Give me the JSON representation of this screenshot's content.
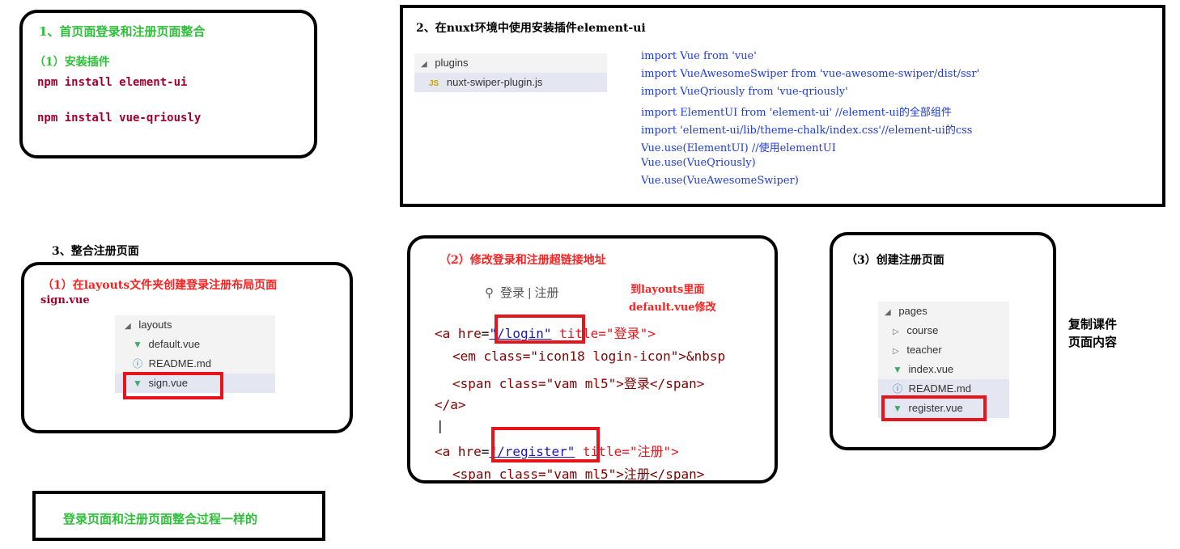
{
  "step1": {
    "title": "1、首页面登录和注册页面整合",
    "subtitle": "（1）安装插件",
    "cmd1": "npm install element-ui",
    "cmd2": "npm install vue-qriously"
  },
  "step2": {
    "title": "2、在nuxt环境中使用安装插件element-ui",
    "tree": {
      "folder": "plugins",
      "file_badge": "JS",
      "file": "nuxt-swiper-plugin.js"
    },
    "code": [
      "import Vue from 'vue'",
      "import VueAwesomeSwiper from 'vue-awesome-swiper/dist/ssr'",
      "import VueQriously from 'vue-qriously'",
      "import ElementUI from 'element-ui' //element-ui的全部组件",
      "import 'element-ui/lib/theme-chalk/index.css'//element-ui的css",
      "Vue.use(ElementUI) //使用elementUI",
      "Vue.use(VueQriously)",
      "Vue.use(VueAwesomeSwiper)"
    ]
  },
  "step3": {
    "title": "3、整合注册页面",
    "sub1_line1": "（1）在layouts文件夹创建登录注册布局页面",
    "sub1_line2": "sign.vue",
    "tree": {
      "folder": "layouts",
      "items": [
        "default.vue",
        "README.md",
        "sign.vue"
      ]
    }
  },
  "step4": {
    "title": "（2）修改登录和注册超链接地址",
    "login_widget": {
      "login": "登录",
      "sep": "|",
      "register": "注册"
    },
    "note_line1": "到layouts里面",
    "note_line2": "default.vue修改",
    "code": {
      "a_open": "<a hre",
      "login_eq": "=",
      "login_href": "\"/login\"",
      "login_title": " title=\"登录\">",
      "em_line": "<em class=\"icon18 login-icon\">&nbsp",
      "span_login": "<span class=\"vam ml5\">登录</span>",
      "a_close": "</a>",
      "cursor": "|",
      "register_href": "\"/register\"",
      "register_title": " title=\"注册\">",
      "span_register": "<span class=\"vam ml5\">注册</span>"
    }
  },
  "step5": {
    "title": "（3）创建注册页面",
    "tree": {
      "folder": "pages",
      "items": [
        "course",
        "teacher",
        "index.vue",
        "README.md",
        "register.vue"
      ]
    },
    "side_note_line1": "复制课件",
    "side_note_line2": "页面内容"
  },
  "footer": {
    "text": "登录页面和注册页面整合过程一样的"
  },
  "colors": {
    "green": "#2fbf3a",
    "dark_red": "#a4002d",
    "red": "#ff1f1f",
    "blue": "#1f3bd8",
    "highlight": "#e8141b"
  },
  "icons": [
    "caret-down-icon",
    "caret-right-icon",
    "vue-file-icon",
    "js-file-icon",
    "info-icon",
    "user-icon"
  ]
}
